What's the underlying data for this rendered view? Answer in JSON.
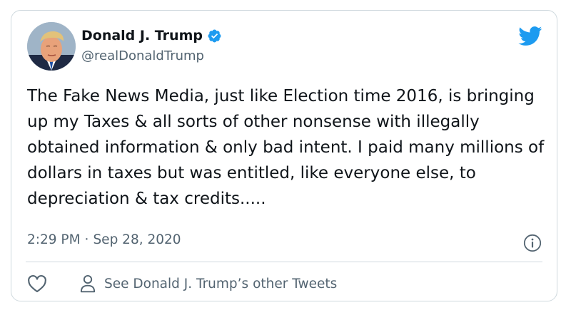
{
  "tweet": {
    "author": {
      "display_name": "Donald J. Trump",
      "handle": "@realDonaldTrump",
      "verified": true
    },
    "text": "The Fake News Media, just like Election time 2016, is bringing up my Taxes & all sorts of other nonsense with illegally obtained information & only bad intent. I paid many millions of dollars in taxes but was entitled, like everyone else, to depreciation & tax credits.....",
    "time": "2:29 PM",
    "separator": "·",
    "date": "Sep 28, 2020",
    "actions": {
      "other_tweets_label": "See Donald J. Trump’s other Tweets"
    }
  },
  "icons": {
    "logo": "twitter-bird-icon",
    "verified": "verified-badge-icon",
    "info": "info-icon",
    "like": "heart-icon",
    "profile": "person-icon"
  },
  "colors": {
    "brand": "#1d9bf0",
    "text": "#0f1419",
    "secondary_text": "#536471",
    "border": "#cfd9de"
  }
}
